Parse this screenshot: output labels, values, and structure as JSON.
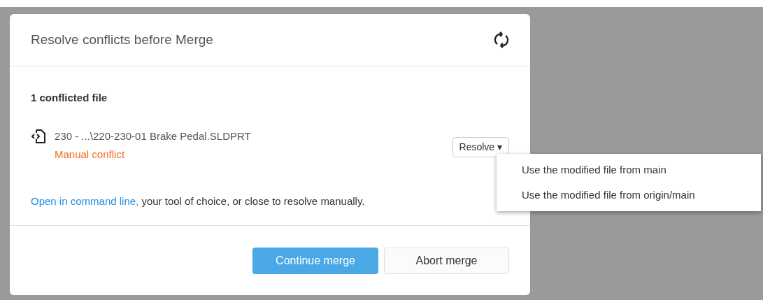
{
  "dialog": {
    "title": "Resolve conflicts before Merge",
    "summary": "1 conflicted file",
    "files": [
      {
        "path": "230 - ...\\220-230-01 Brake Pedal.SLDPRT",
        "status": "Manual conflict",
        "resolve_button": "Resolve ▾"
      }
    ],
    "hint": {
      "link": "Open in command line,",
      "rest": " your tool of choice, or close to resolve manually."
    },
    "buttons": [
      {
        "label": "Continue merge",
        "kind": "primary"
      },
      {
        "label": "Abort merge",
        "kind": "secondary"
      }
    ]
  },
  "menu": {
    "items": [
      "Use the modified file from main",
      "Use the modified file from origin/main"
    ]
  }
}
